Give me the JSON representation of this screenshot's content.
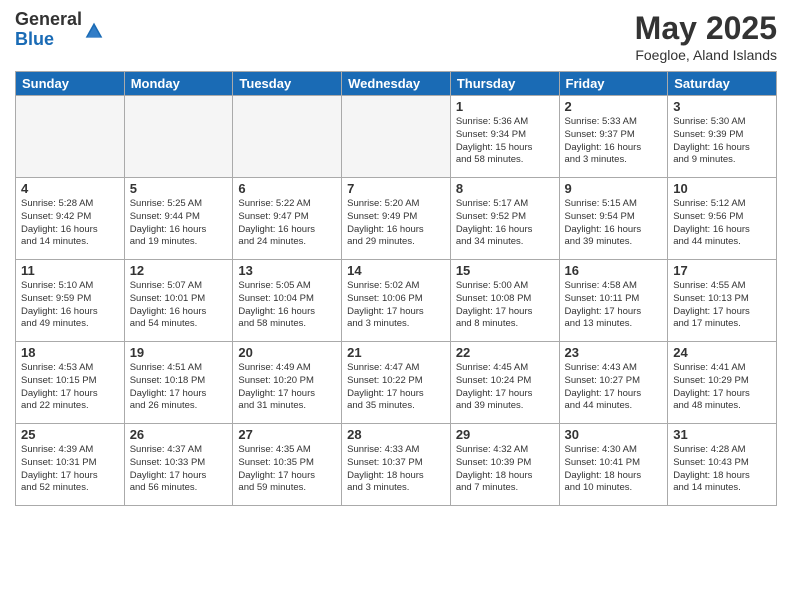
{
  "logo": {
    "general": "General",
    "blue": "Blue"
  },
  "title": "May 2025",
  "subtitle": "Foegloe, Aland Islands",
  "headers": [
    "Sunday",
    "Monday",
    "Tuesday",
    "Wednesday",
    "Thursday",
    "Friday",
    "Saturday"
  ],
  "weeks": [
    [
      {
        "day": "",
        "info": ""
      },
      {
        "day": "",
        "info": ""
      },
      {
        "day": "",
        "info": ""
      },
      {
        "day": "",
        "info": ""
      },
      {
        "day": "1",
        "info": "Sunrise: 5:36 AM\nSunset: 9:34 PM\nDaylight: 15 hours\nand 58 minutes."
      },
      {
        "day": "2",
        "info": "Sunrise: 5:33 AM\nSunset: 9:37 PM\nDaylight: 16 hours\nand 3 minutes."
      },
      {
        "day": "3",
        "info": "Sunrise: 5:30 AM\nSunset: 9:39 PM\nDaylight: 16 hours\nand 9 minutes."
      }
    ],
    [
      {
        "day": "4",
        "info": "Sunrise: 5:28 AM\nSunset: 9:42 PM\nDaylight: 16 hours\nand 14 minutes."
      },
      {
        "day": "5",
        "info": "Sunrise: 5:25 AM\nSunset: 9:44 PM\nDaylight: 16 hours\nand 19 minutes."
      },
      {
        "day": "6",
        "info": "Sunrise: 5:22 AM\nSunset: 9:47 PM\nDaylight: 16 hours\nand 24 minutes."
      },
      {
        "day": "7",
        "info": "Sunrise: 5:20 AM\nSunset: 9:49 PM\nDaylight: 16 hours\nand 29 minutes."
      },
      {
        "day": "8",
        "info": "Sunrise: 5:17 AM\nSunset: 9:52 PM\nDaylight: 16 hours\nand 34 minutes."
      },
      {
        "day": "9",
        "info": "Sunrise: 5:15 AM\nSunset: 9:54 PM\nDaylight: 16 hours\nand 39 minutes."
      },
      {
        "day": "10",
        "info": "Sunrise: 5:12 AM\nSunset: 9:56 PM\nDaylight: 16 hours\nand 44 minutes."
      }
    ],
    [
      {
        "day": "11",
        "info": "Sunrise: 5:10 AM\nSunset: 9:59 PM\nDaylight: 16 hours\nand 49 minutes."
      },
      {
        "day": "12",
        "info": "Sunrise: 5:07 AM\nSunset: 10:01 PM\nDaylight: 16 hours\nand 54 minutes."
      },
      {
        "day": "13",
        "info": "Sunrise: 5:05 AM\nSunset: 10:04 PM\nDaylight: 16 hours\nand 58 minutes."
      },
      {
        "day": "14",
        "info": "Sunrise: 5:02 AM\nSunset: 10:06 PM\nDaylight: 17 hours\nand 3 minutes."
      },
      {
        "day": "15",
        "info": "Sunrise: 5:00 AM\nSunset: 10:08 PM\nDaylight: 17 hours\nand 8 minutes."
      },
      {
        "day": "16",
        "info": "Sunrise: 4:58 AM\nSunset: 10:11 PM\nDaylight: 17 hours\nand 13 minutes."
      },
      {
        "day": "17",
        "info": "Sunrise: 4:55 AM\nSunset: 10:13 PM\nDaylight: 17 hours\nand 17 minutes."
      }
    ],
    [
      {
        "day": "18",
        "info": "Sunrise: 4:53 AM\nSunset: 10:15 PM\nDaylight: 17 hours\nand 22 minutes."
      },
      {
        "day": "19",
        "info": "Sunrise: 4:51 AM\nSunset: 10:18 PM\nDaylight: 17 hours\nand 26 minutes."
      },
      {
        "day": "20",
        "info": "Sunrise: 4:49 AM\nSunset: 10:20 PM\nDaylight: 17 hours\nand 31 minutes."
      },
      {
        "day": "21",
        "info": "Sunrise: 4:47 AM\nSunset: 10:22 PM\nDaylight: 17 hours\nand 35 minutes."
      },
      {
        "day": "22",
        "info": "Sunrise: 4:45 AM\nSunset: 10:24 PM\nDaylight: 17 hours\nand 39 minutes."
      },
      {
        "day": "23",
        "info": "Sunrise: 4:43 AM\nSunset: 10:27 PM\nDaylight: 17 hours\nand 44 minutes."
      },
      {
        "day": "24",
        "info": "Sunrise: 4:41 AM\nSunset: 10:29 PM\nDaylight: 17 hours\nand 48 minutes."
      }
    ],
    [
      {
        "day": "25",
        "info": "Sunrise: 4:39 AM\nSunset: 10:31 PM\nDaylight: 17 hours\nand 52 minutes."
      },
      {
        "day": "26",
        "info": "Sunrise: 4:37 AM\nSunset: 10:33 PM\nDaylight: 17 hours\nand 56 minutes."
      },
      {
        "day": "27",
        "info": "Sunrise: 4:35 AM\nSunset: 10:35 PM\nDaylight: 17 hours\nand 59 minutes."
      },
      {
        "day": "28",
        "info": "Sunrise: 4:33 AM\nSunset: 10:37 PM\nDaylight: 18 hours\nand 3 minutes."
      },
      {
        "day": "29",
        "info": "Sunrise: 4:32 AM\nSunset: 10:39 PM\nDaylight: 18 hours\nand 7 minutes."
      },
      {
        "day": "30",
        "info": "Sunrise: 4:30 AM\nSunset: 10:41 PM\nDaylight: 18 hours\nand 10 minutes."
      },
      {
        "day": "31",
        "info": "Sunrise: 4:28 AM\nSunset: 10:43 PM\nDaylight: 18 hours\nand 14 minutes."
      }
    ]
  ]
}
